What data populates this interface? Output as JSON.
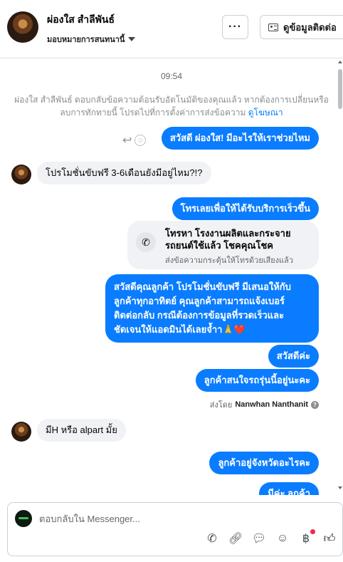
{
  "header": {
    "contact_name": "ผ่องใส สำลีพันธ์",
    "assign_label": "มอบหมายการสนทนานี้",
    "more_label": "···",
    "contact_info_label": "ดูข้อมูลติดต่อ"
  },
  "thread": {
    "time": "09:54",
    "notice_text": "ผ่องใส สำลีพันธ์ ตอบกลับข้อความต้อนรับอัตโนมัติของคุณแล้ว หากต้องการเปลี่ยนหรือลบการทักทายนี้ โปรดไปที่การตั้งค่าการส่งข้อความ",
    "notice_link": "ดูโฆษณา",
    "messages": [
      {
        "text": "สวัสดี ผ่องใส! มีอะไรให้เราช่วยไหม"
      },
      {
        "text": "โปรโมชั่นขับฟรี 3-6เดือนยังมีอยู่ไหม?!?"
      },
      {
        "text": "โทรเลยเพื่อให้ได้รับบริการเร็วขึ้น"
      },
      {
        "text": "สวัสดีคุณลูกค้า โปรโมชั่นขับฟรี มีเสนอให้กับลูกค้าทุกอาทิตย์ คุณลูกค้าสามารถแจ้งเบอร์ ติดต่อกลับ กรณีต้องการข้อมูลที่รวดเร็วและชัดเจนให้แอดมินได้เลยจ้ำา🙏❤️"
      },
      {
        "text": "สวัสดีค่ะ"
      },
      {
        "text": "ลูกค้าสนใจรถรุ่นนี้อยู่นะคะ"
      },
      {
        "text": "มีH  หรือ alpart มั้ย"
      },
      {
        "text": "ลูกค้าอยู่จังหวัดอะไรคะ"
      },
      {
        "text": "มีค่ะ ลูกค้า"
      }
    ],
    "call_card": {
      "title": "โทรหา โรงงานผลิตและกระจายรถยนต์ใช้แล้ว โชคคุณโชค",
      "subtitle": "ส่งข้อความกระตุ้นให้โทรด้วยเสียงแล้ว"
    },
    "sent_by": {
      "prefix": "ส่งโดย",
      "name": "Nanwhan Nanthanit"
    }
  },
  "composer": {
    "placeholder": "ตอบกลับใน Messenger..."
  },
  "colors": {
    "accent": "#0a7cff",
    "incoming_bubble": "#f0f2f5",
    "badge": "#f02849"
  }
}
